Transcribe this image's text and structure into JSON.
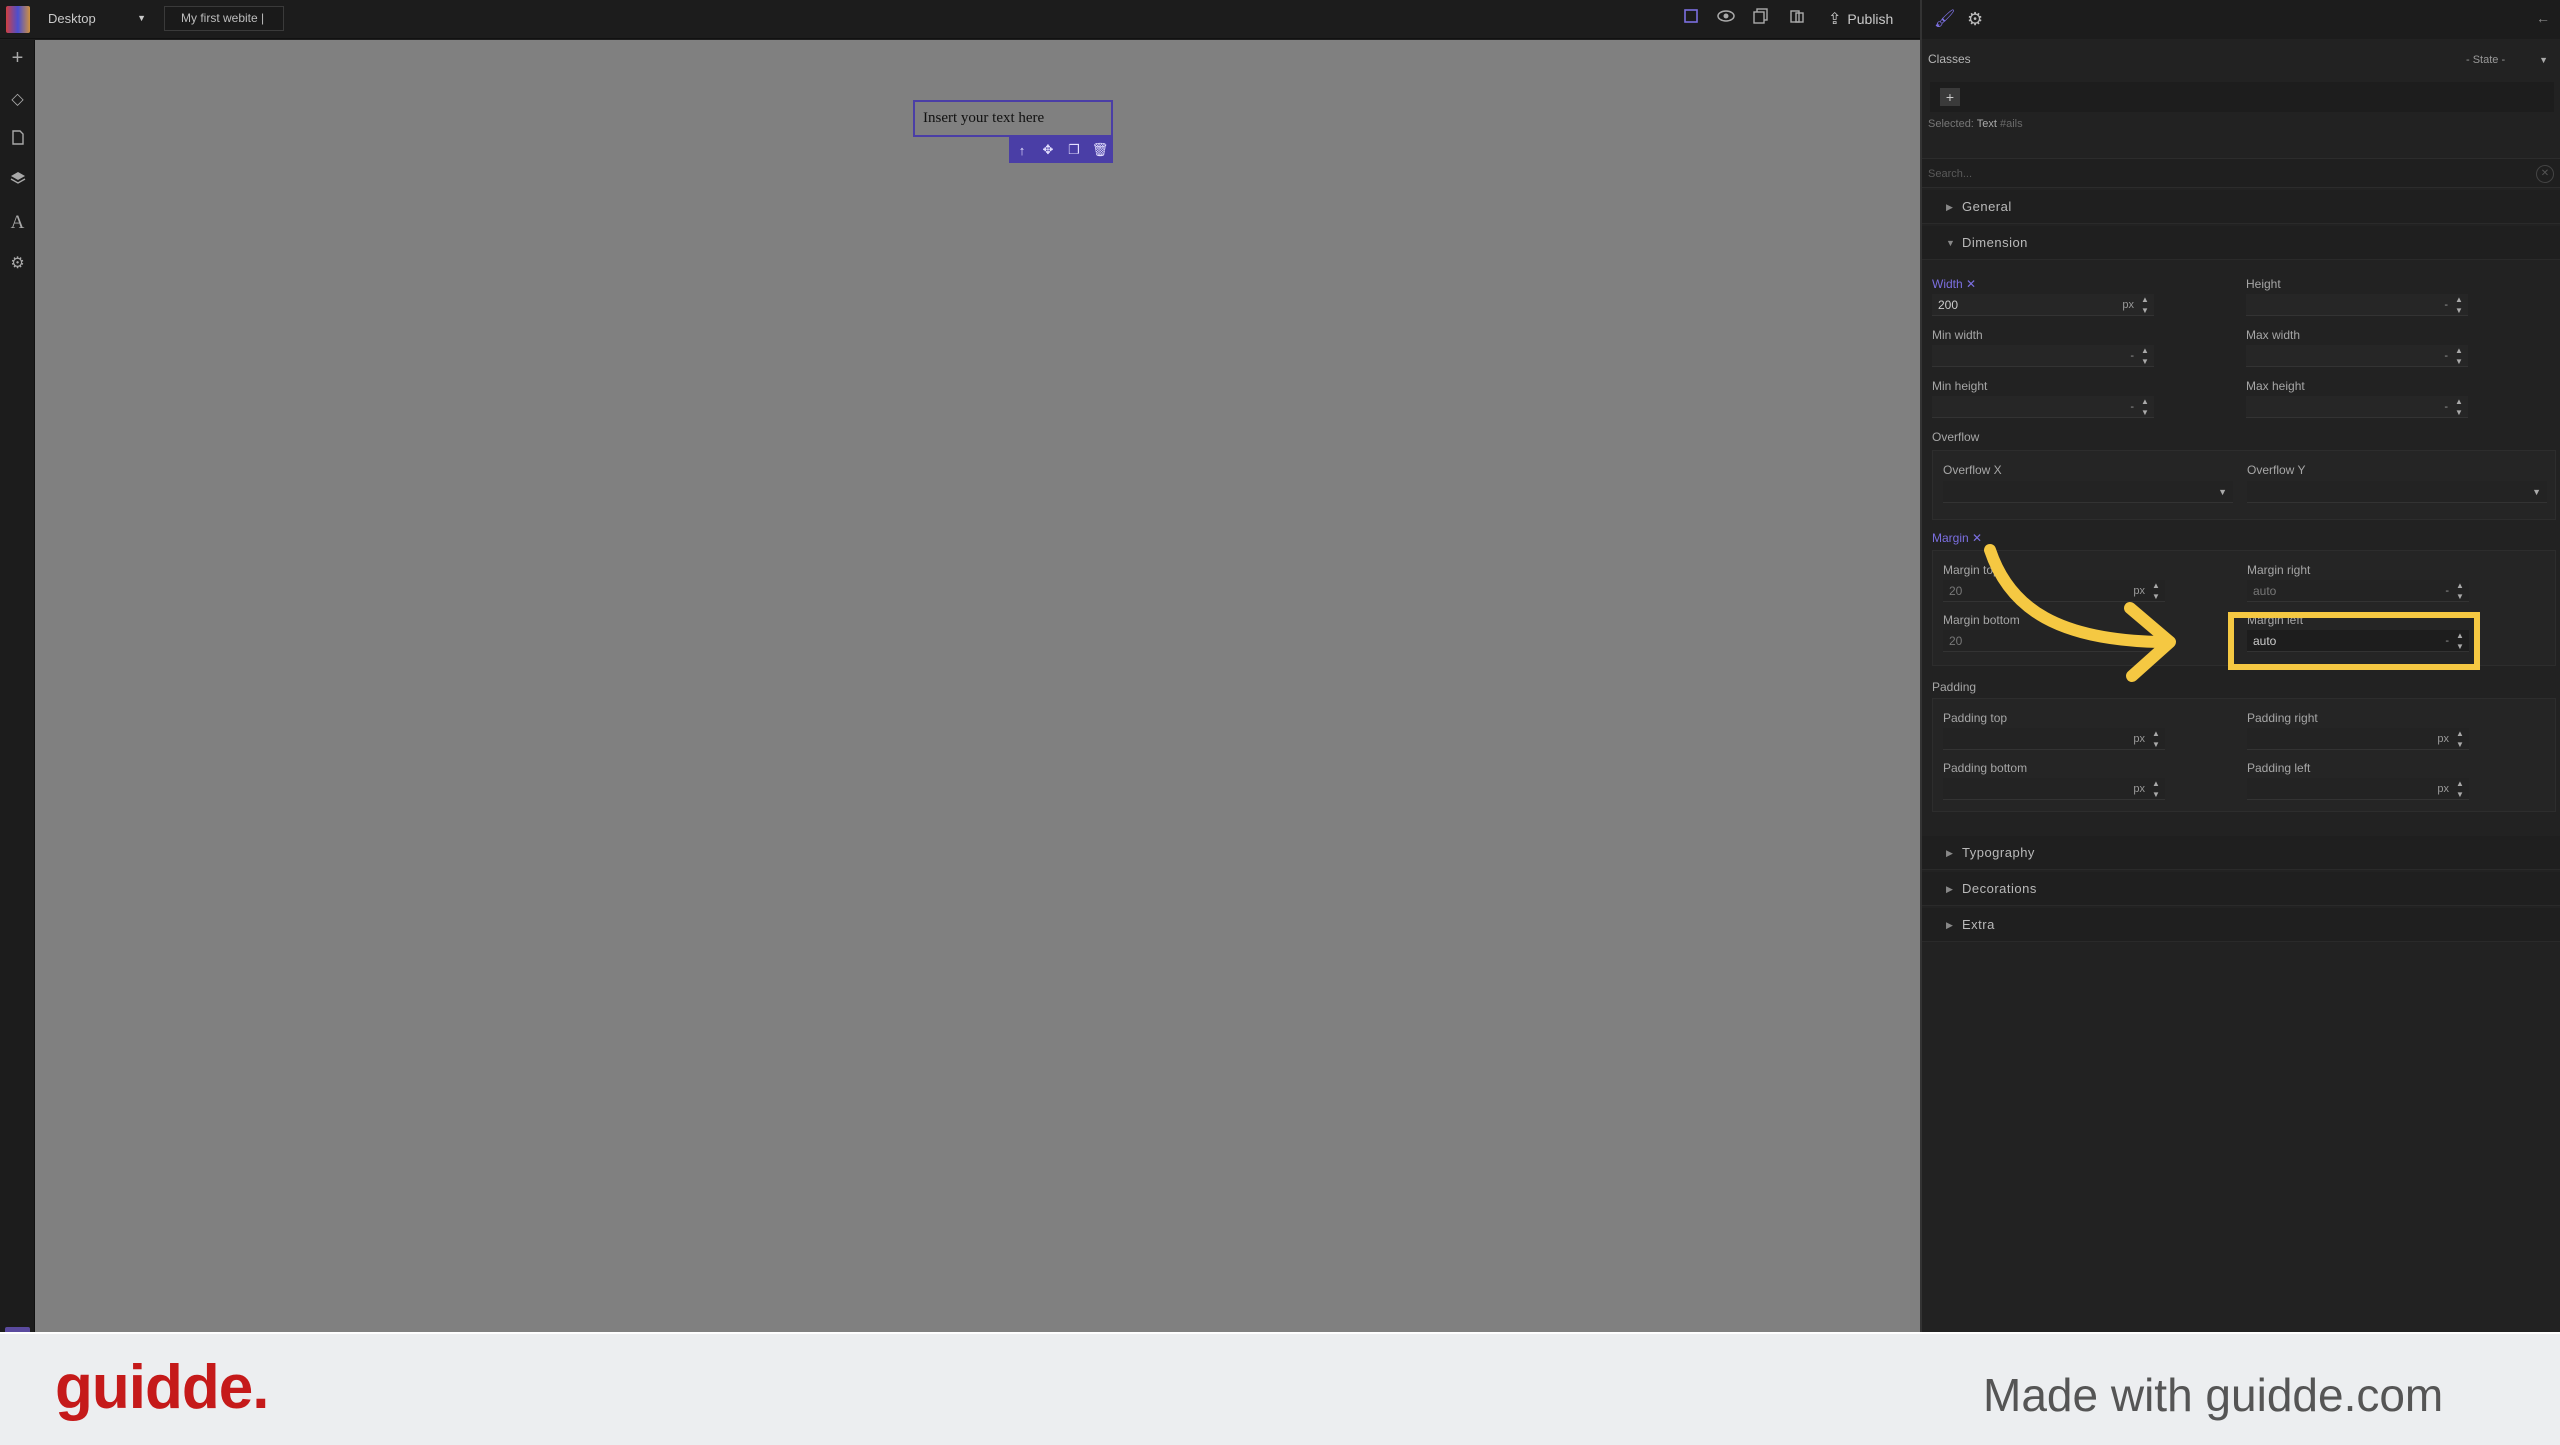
{
  "topbar": {
    "device": "Desktop",
    "site_name": "My first webite |",
    "publish_label": "Publish"
  },
  "canvas": {
    "text_block": "Insert your text here"
  },
  "panel": {
    "classes_label": "Classes",
    "state_select": "- State -",
    "add_class": "+",
    "selected_prefix": "Selected:",
    "selected_name": "Text",
    "selected_id": "#ails",
    "search_placeholder": "Search...",
    "sectors": {
      "general": "General",
      "dimension": "Dimension",
      "typography": "Typography",
      "decorations": "Decorations",
      "extra": "Extra"
    },
    "dimension": {
      "width_label": "Width",
      "width_value": "200",
      "width_unit": "px",
      "height_label": "Height",
      "height_unit": "-",
      "min_width_label": "Min width",
      "min_width_unit": "-",
      "max_width_label": "Max width",
      "max_width_unit": "-",
      "min_height_label": "Min height",
      "min_height_unit": "-",
      "max_height_label": "Max height",
      "max_height_unit": "-",
      "overflow_label": "Overflow",
      "overflow_x_label": "Overflow X",
      "overflow_y_label": "Overflow Y",
      "margin_label": "Margin",
      "margin_top_label": "Margin top",
      "margin_top_value": "20",
      "margin_top_unit": "px",
      "margin_right_label": "Margin right",
      "margin_right_value": "auto",
      "margin_right_unit": "-",
      "margin_bottom_label": "Margin bottom",
      "margin_bottom_value": "20",
      "margin_left_label": "Margin left",
      "margin_left_value": "auto",
      "margin_left_unit": "-",
      "padding_label": "Padding",
      "padding_top_label": "Padding top",
      "padding_right_label": "Padding right",
      "padding_bottom_label": "Padding bottom",
      "padding_left_label": "Padding left",
      "padding_unit": "px"
    }
  },
  "footer": {
    "brand": "guidde.",
    "made_with": "Made with guidde.com"
  },
  "colors": {
    "accent": "#7b6fe0",
    "selection": "#4a3ea6",
    "highlight": "#f5c842",
    "brand_red": "#c51a1a"
  }
}
